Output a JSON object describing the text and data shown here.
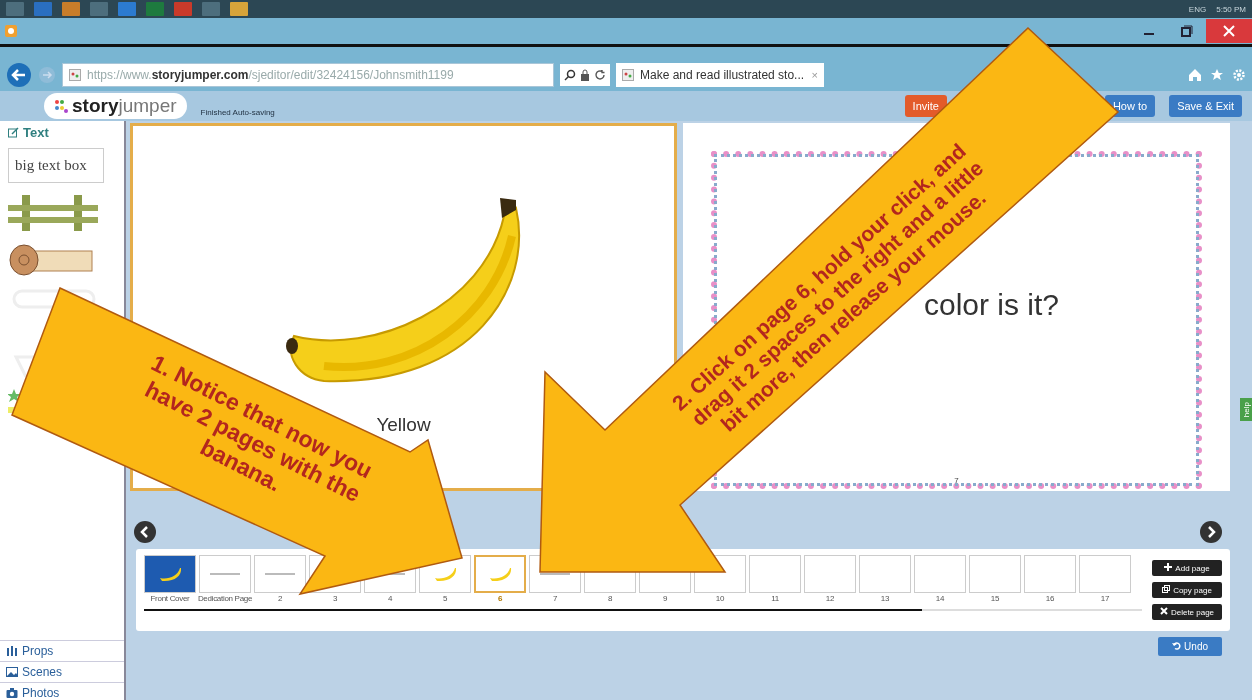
{
  "taskbar": {
    "language": "ENG",
    "clock": "5:50 PM"
  },
  "browser": {
    "url": "https://www.**storyjumper.com**/sjeditor/edit/32424156/Johnsmith1199",
    "tab_title": "Make and read illustrated sto...",
    "tab_close": "×"
  },
  "app_header": {
    "logo": "**story**jumper",
    "status": "Finished Auto-saving",
    "buttons": [
      {
        "label": "Invite",
        "kind": "orange"
      },
      {
        "label": "How to",
        "kind": "blue"
      },
      {
        "label": "Save & Exit",
        "kind": "blue"
      }
    ]
  },
  "sidebar": {
    "section": "Text",
    "items": [
      {
        "kind": "textbox",
        "label": "big text box"
      },
      {
        "kind": "fence"
      },
      {
        "kind": "scroll"
      },
      {
        "kind": "bubble"
      },
      {
        "kind": "stars"
      }
    ],
    "tabs": [
      {
        "label": "Props",
        "kind": "props"
      },
      {
        "label": "Scenes",
        "kind": "scenes"
      },
      {
        "label": "Photos",
        "kind": "photos"
      }
    ]
  },
  "pages": {
    "left": {
      "caption": "Yellow",
      "selected": true
    },
    "right": {
      "text": "color is it?",
      "page_number": "7"
    }
  },
  "thumbnails": [
    {
      "label": "Front Cover",
      "kind": "cover",
      "selected": false
    },
    {
      "label": "Dedication Page",
      "kind": "text",
      "selected": false
    },
    {
      "label": "2",
      "kind": "text",
      "selected": false
    },
    {
      "label": "3",
      "kind": "text",
      "selected": false
    },
    {
      "label": "4",
      "kind": "text",
      "selected": false
    },
    {
      "label": "5",
      "kind": "banana",
      "selected": false
    },
    {
      "label": "6",
      "kind": "banana",
      "selected": true
    },
    {
      "label": "7",
      "kind": "text",
      "selected": false
    },
    {
      "label": "8",
      "kind": "blank",
      "selected": false
    },
    {
      "label": "9",
      "kind": "blank",
      "selected": false
    },
    {
      "label": "10",
      "kind": "blank",
      "selected": false
    },
    {
      "label": "11",
      "kind": "blank",
      "selected": false
    },
    {
      "label": "12",
      "kind": "blank",
      "selected": false
    },
    {
      "label": "13",
      "kind": "blank",
      "selected": false
    },
    {
      "label": "14",
      "kind": "blank",
      "selected": false
    },
    {
      "label": "15",
      "kind": "blank",
      "selected": false
    },
    {
      "label": "16",
      "kind": "blank",
      "selected": false
    },
    {
      "label": "17",
      "kind": "blank",
      "selected": false
    }
  ],
  "thumb_scroll": {
    "level": 0.78
  },
  "page_buttons": [
    {
      "label": "Add page",
      "kind": "add"
    },
    {
      "label": "Copy page",
      "kind": "copy"
    },
    {
      "label": "Delete page",
      "kind": "delete"
    }
  ],
  "undo": "Undo",
  "help_tab": "help",
  "callouts": [
    {
      "text": "1. Notice that now you have 2 pages with the banana.",
      "kind": "first"
    },
    {
      "text": "2. Click on page 6, hold your click, and drag it 2 spaces to the right and a little bit more, then release your mouse.",
      "kind": "second"
    }
  ]
}
